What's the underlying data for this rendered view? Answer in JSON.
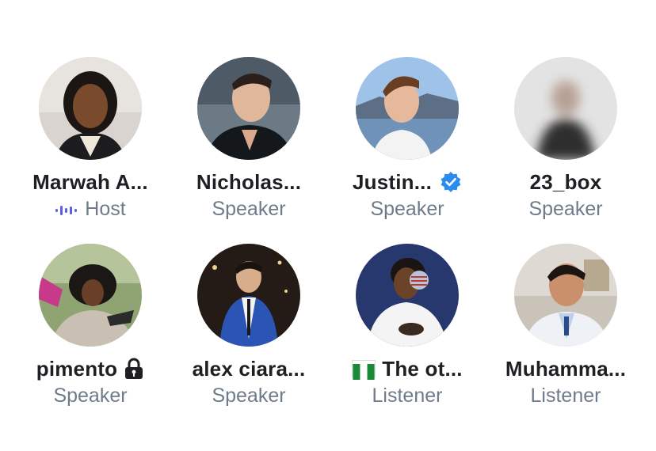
{
  "participants": [
    {
      "name": "Marwah A...",
      "role": "Host"
    },
    {
      "name": "Nicholas...",
      "role": "Speaker"
    },
    {
      "name": "Justin...",
      "role": "Speaker"
    },
    {
      "name": "23_box",
      "role": "Speaker"
    },
    {
      "name": "pimento",
      "role": "Speaker"
    },
    {
      "name": "alex ciara...",
      "role": "Speaker"
    },
    {
      "name": "The ot...",
      "role": "Listener"
    },
    {
      "name": "Muhamma...",
      "role": "Listener"
    }
  ],
  "icons": {
    "host": "audio-wave-icon",
    "verified": "verified-badge-icon",
    "lock": "lock-icon",
    "flag": "nigeria-flag-icon"
  },
  "colors": {
    "name_text": "#1f1f23",
    "role_text": "#6e7b8a",
    "host_accent": "#5b5ee0",
    "verified_blue": "#2b8cf0",
    "flag_green": "#1a8a3a"
  }
}
